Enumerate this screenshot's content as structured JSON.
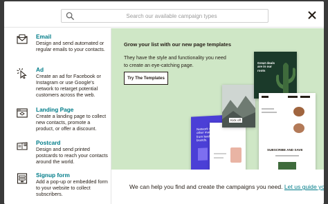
{
  "search": {
    "placeholder": "Search our available campaign types"
  },
  "categories": [
    {
      "title": "Email",
      "icon": "envelope-icon",
      "description": "Design and send automated or regular emails to your contacts."
    },
    {
      "title": "Ad",
      "icon": "click-cursor-icon",
      "description": "Create an ad for Facebook or Instagram or use Google's network to retarget potential customers across the web."
    },
    {
      "title": "Landing Page",
      "icon": "browser-window-icon",
      "description": "Create a landing page to collect new contacts, promote a product, or offer a discount."
    },
    {
      "title": "Postcard",
      "icon": "postcard-icon",
      "description": "Design and send printed postcards to reach your contacts around the world."
    },
    {
      "title": "Signup form",
      "icon": "form-icon",
      "description": "Add a pop-up or embedded form to your website to collect subscribers."
    }
  ],
  "promo": {
    "title": "Grow your list with our new page templates",
    "body": "They have the style and functionality you need to create an eye-catching page.",
    "button": "Try The Templates",
    "background": "#cfe7c6",
    "mock_dark_heading": "Great deals are in our roots",
    "mock_subscribe": "SUBSCRIBE AND SAVE",
    "mock_kick": "Kick off",
    "mock_purple_text": "Network with other marketers from leading brands."
  },
  "footer": {
    "text": "We can help you find and create the campaigns you need.",
    "link": "Let us guide you"
  },
  "colors": {
    "accent": "#007c89",
    "text": "#241c15"
  }
}
